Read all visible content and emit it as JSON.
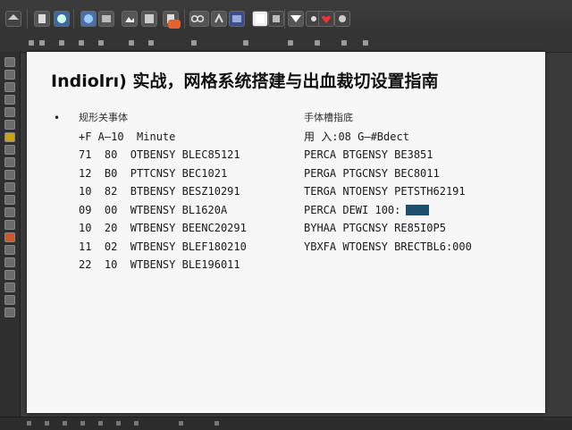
{
  "document": {
    "title": "Indiolrı) 实战，网格系统搭建与出血裁切设置指南",
    "bullet": "•",
    "left_column": {
      "header": "规形关事体",
      "subheader": "+F A—10  Minute",
      "rows": [
        "71  80  OTBENSY BLEC85121",
        "12  B0  PTTCNSY BEC1021",
        "10  82  BTBENSY BESZ10291",
        "09  00  WTBENSY BL1620A",
        "10  20  WTBENSY BEENC20291",
        "11  02  WTBENSY BLEF180210",
        "22  10  WTBENSY BLE196011"
      ]
    },
    "right_column": {
      "header": "手体槽指底",
      "subheader": "用 入:08 G—#Bdect",
      "rows": [
        "PERCA BTGENSY BE3851",
        "PERGA PTGCNSY BEC8011",
        "TERGA NTOENSY PETSTH62191",
        "PERCA DEWI 100:",
        "BYHAA PTGCNSY RE85I0P5",
        "YBXFA WTOENSY BRECTBL6:000"
      ]
    }
  },
  "icons": {
    "toolbar": [
      "home-icon",
      "file-icon",
      "folder-icon",
      "settings-icon",
      "gear-icon",
      "image-icon",
      "text-icon",
      "clipboard-icon",
      "image-icon",
      "link-icon",
      "share-icon",
      "select-icon",
      "wand-icon",
      "shape-icon",
      "funnel-icon",
      "star-icon",
      "heart-icon",
      "settings-icon"
    ],
    "highlight_color": "#1f4f6e"
  }
}
